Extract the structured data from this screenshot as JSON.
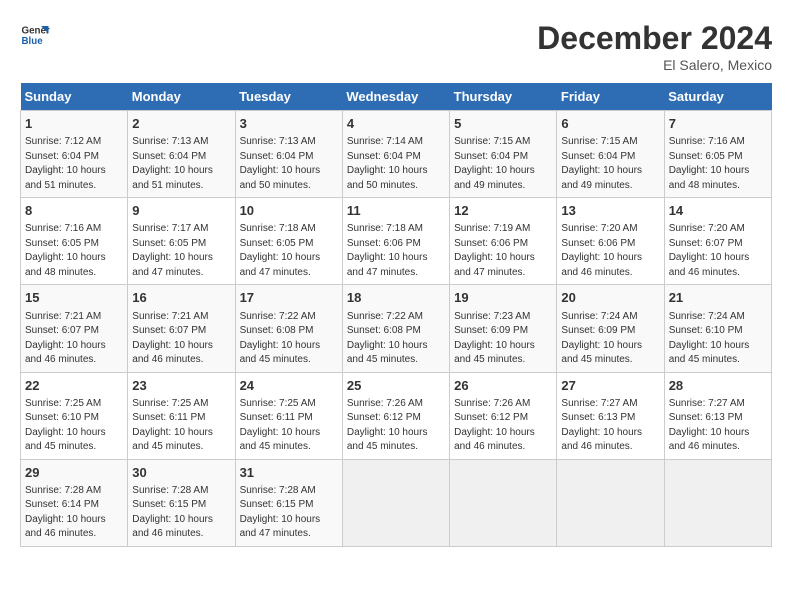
{
  "logo": {
    "line1": "General",
    "line2": "Blue"
  },
  "title": "December 2024",
  "subtitle": "El Salero, Mexico",
  "days_header": [
    "Sunday",
    "Monday",
    "Tuesday",
    "Wednesday",
    "Thursday",
    "Friday",
    "Saturday"
  ],
  "weeks": [
    [
      {
        "day": "1",
        "info": "Sunrise: 7:12 AM\nSunset: 6:04 PM\nDaylight: 10 hours\nand 51 minutes."
      },
      {
        "day": "2",
        "info": "Sunrise: 7:13 AM\nSunset: 6:04 PM\nDaylight: 10 hours\nand 51 minutes."
      },
      {
        "day": "3",
        "info": "Sunrise: 7:13 AM\nSunset: 6:04 PM\nDaylight: 10 hours\nand 50 minutes."
      },
      {
        "day": "4",
        "info": "Sunrise: 7:14 AM\nSunset: 6:04 PM\nDaylight: 10 hours\nand 50 minutes."
      },
      {
        "day": "5",
        "info": "Sunrise: 7:15 AM\nSunset: 6:04 PM\nDaylight: 10 hours\nand 49 minutes."
      },
      {
        "day": "6",
        "info": "Sunrise: 7:15 AM\nSunset: 6:04 PM\nDaylight: 10 hours\nand 49 minutes."
      },
      {
        "day": "7",
        "info": "Sunrise: 7:16 AM\nSunset: 6:05 PM\nDaylight: 10 hours\nand 48 minutes."
      }
    ],
    [
      {
        "day": "8",
        "info": "Sunrise: 7:16 AM\nSunset: 6:05 PM\nDaylight: 10 hours\nand 48 minutes."
      },
      {
        "day": "9",
        "info": "Sunrise: 7:17 AM\nSunset: 6:05 PM\nDaylight: 10 hours\nand 47 minutes."
      },
      {
        "day": "10",
        "info": "Sunrise: 7:18 AM\nSunset: 6:05 PM\nDaylight: 10 hours\nand 47 minutes."
      },
      {
        "day": "11",
        "info": "Sunrise: 7:18 AM\nSunset: 6:06 PM\nDaylight: 10 hours\nand 47 minutes."
      },
      {
        "day": "12",
        "info": "Sunrise: 7:19 AM\nSunset: 6:06 PM\nDaylight: 10 hours\nand 47 minutes."
      },
      {
        "day": "13",
        "info": "Sunrise: 7:20 AM\nSunset: 6:06 PM\nDaylight: 10 hours\nand 46 minutes."
      },
      {
        "day": "14",
        "info": "Sunrise: 7:20 AM\nSunset: 6:07 PM\nDaylight: 10 hours\nand 46 minutes."
      }
    ],
    [
      {
        "day": "15",
        "info": "Sunrise: 7:21 AM\nSunset: 6:07 PM\nDaylight: 10 hours\nand 46 minutes."
      },
      {
        "day": "16",
        "info": "Sunrise: 7:21 AM\nSunset: 6:07 PM\nDaylight: 10 hours\nand 46 minutes."
      },
      {
        "day": "17",
        "info": "Sunrise: 7:22 AM\nSunset: 6:08 PM\nDaylight: 10 hours\nand 45 minutes."
      },
      {
        "day": "18",
        "info": "Sunrise: 7:22 AM\nSunset: 6:08 PM\nDaylight: 10 hours\nand 45 minutes."
      },
      {
        "day": "19",
        "info": "Sunrise: 7:23 AM\nSunset: 6:09 PM\nDaylight: 10 hours\nand 45 minutes."
      },
      {
        "day": "20",
        "info": "Sunrise: 7:24 AM\nSunset: 6:09 PM\nDaylight: 10 hours\nand 45 minutes."
      },
      {
        "day": "21",
        "info": "Sunrise: 7:24 AM\nSunset: 6:10 PM\nDaylight: 10 hours\nand 45 minutes."
      }
    ],
    [
      {
        "day": "22",
        "info": "Sunrise: 7:25 AM\nSunset: 6:10 PM\nDaylight: 10 hours\nand 45 minutes."
      },
      {
        "day": "23",
        "info": "Sunrise: 7:25 AM\nSunset: 6:11 PM\nDaylight: 10 hours\nand 45 minutes."
      },
      {
        "day": "24",
        "info": "Sunrise: 7:25 AM\nSunset: 6:11 PM\nDaylight: 10 hours\nand 45 minutes."
      },
      {
        "day": "25",
        "info": "Sunrise: 7:26 AM\nSunset: 6:12 PM\nDaylight: 10 hours\nand 45 minutes."
      },
      {
        "day": "26",
        "info": "Sunrise: 7:26 AM\nSunset: 6:12 PM\nDaylight: 10 hours\nand 46 minutes."
      },
      {
        "day": "27",
        "info": "Sunrise: 7:27 AM\nSunset: 6:13 PM\nDaylight: 10 hours\nand 46 minutes."
      },
      {
        "day": "28",
        "info": "Sunrise: 7:27 AM\nSunset: 6:13 PM\nDaylight: 10 hours\nand 46 minutes."
      }
    ],
    [
      {
        "day": "29",
        "info": "Sunrise: 7:28 AM\nSunset: 6:14 PM\nDaylight: 10 hours\nand 46 minutes."
      },
      {
        "day": "30",
        "info": "Sunrise: 7:28 AM\nSunset: 6:15 PM\nDaylight: 10 hours\nand 46 minutes."
      },
      {
        "day": "31",
        "info": "Sunrise: 7:28 AM\nSunset: 6:15 PM\nDaylight: 10 hours\nand 47 minutes."
      },
      {
        "day": "",
        "info": ""
      },
      {
        "day": "",
        "info": ""
      },
      {
        "day": "",
        "info": ""
      },
      {
        "day": "",
        "info": ""
      }
    ]
  ]
}
